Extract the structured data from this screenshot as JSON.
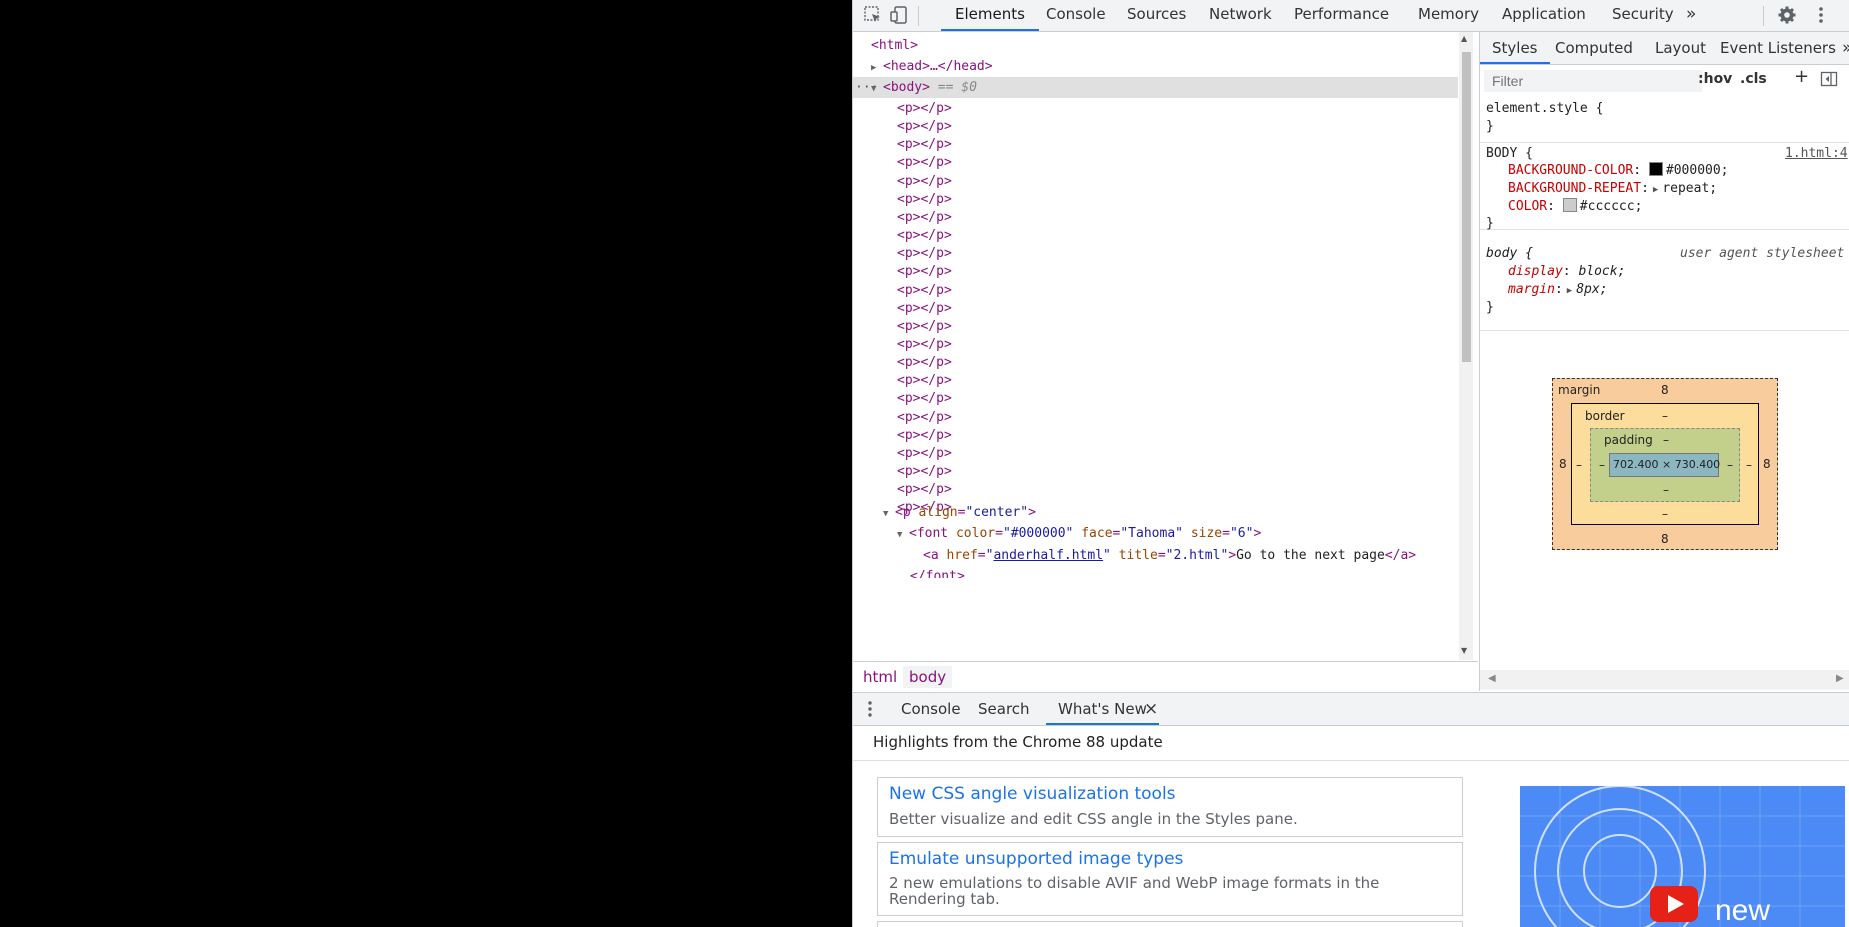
{
  "toolbar": {
    "tabs": [
      "Elements",
      "Console",
      "Sources",
      "Network",
      "Performance",
      "Memory",
      "Application",
      "Security"
    ],
    "more": "»"
  },
  "dom": {
    "html_open": "<html>",
    "head": "<head>…</head>",
    "body_open": "<body>",
    "body_marker": "== $0",
    "p_empty": "<p></p>",
    "p_align_open_tag": "<p",
    "p_align_attr": "align",
    "p_align_val": "\"center\"",
    "font_tag": "<font",
    "font_color_attr": "color",
    "font_color_val": "\"#000000\"",
    "font_face_attr": "face",
    "font_face_val": "\"Tahoma\"",
    "font_size_attr": "size",
    "font_size_val": "\"6\"",
    "a_tag": "<a",
    "a_href_attr": "href",
    "a_href_val": "anderhalf.html",
    "a_title_attr": "title",
    "a_title_val": "\"2.html\"",
    "a_text": "Go to the next page",
    "a_close": "</a>",
    "font_close": "</font>"
  },
  "breadcrumb": [
    "html",
    "body"
  ],
  "styles": {
    "tabs": [
      "Styles",
      "Computed",
      "Layout",
      "Event Listeners"
    ],
    "more": "»",
    "filter_placeholder": "Filter",
    "hov": ":hov",
    "cls": ".cls",
    "plus": "+",
    "element_style": "element.style {",
    "close_brace": "}",
    "body_selector": "BODY {",
    "body_source": "1.html:4",
    "bg_prop": "BACKGROUND-COLOR",
    "bg_val": "#000000;",
    "bg_color": "#000000",
    "repeat_prop": "BACKGROUND-REPEAT",
    "repeat_val": "repeat;",
    "color_prop": "COLOR",
    "color_val": "#cccccc;",
    "color_color": "#cccccc",
    "ua_selector": "body {",
    "ua_source": "user agent stylesheet",
    "display_prop": "display",
    "display_val": "block;",
    "margin_prop": "margin",
    "margin_val": "8px;"
  },
  "boxmodel": {
    "margin_label": "margin",
    "border_label": "border",
    "padding_label": "padding",
    "margin_top": "8",
    "margin_bottom": "8",
    "margin_left": "8",
    "margin_right": "8",
    "border_dash": "–",
    "padding_dash": "–",
    "content": "702.400 × 730.400"
  },
  "drawer": {
    "tabs": [
      "Console",
      "Search",
      "What's New"
    ],
    "close": "×",
    "heading": "Highlights from the Chrome 88 update",
    "cards": [
      {
        "title": "New CSS angle visualization tools",
        "desc": "Better visualize and edit CSS angle in the Styles pane."
      },
      {
        "title": "Emulate unsupported image types",
        "desc": "2 new emulations to disable AVIF and WebP image formats in the Rendering tab."
      }
    ],
    "video_text": "new"
  }
}
